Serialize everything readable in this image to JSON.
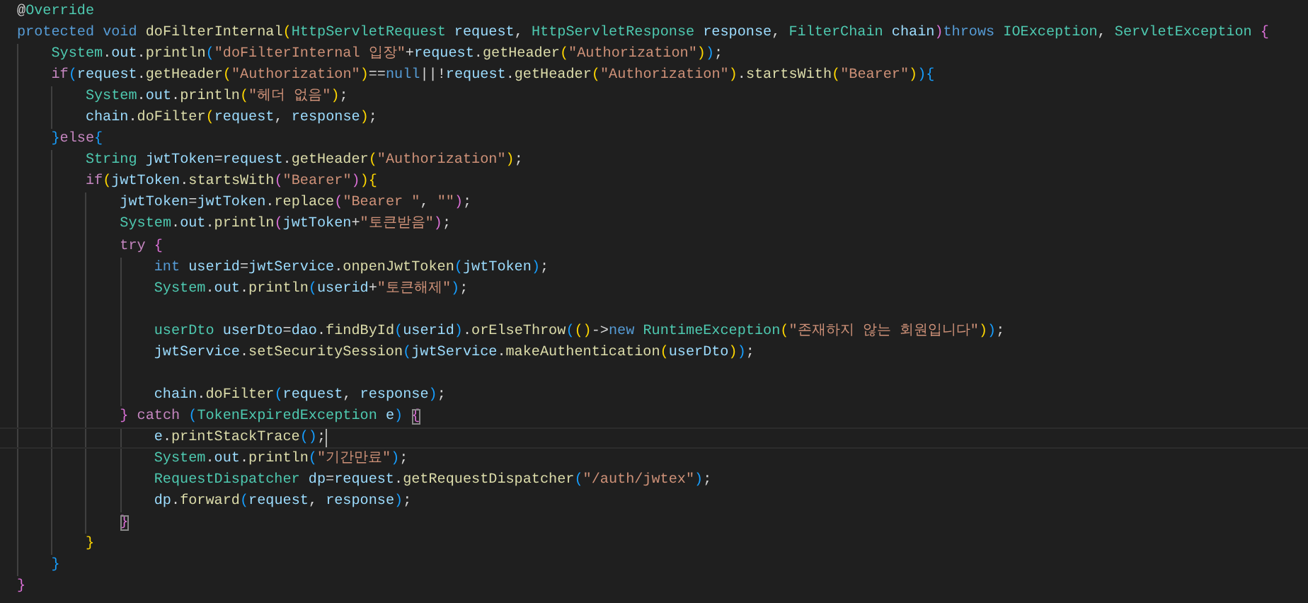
{
  "editor": {
    "lines": [
      {
        "current": false,
        "tokens": [
          {
            "kind": "plain",
            "text": "@"
          },
          {
            "kind": "type",
            "text": "Override"
          }
        ]
      },
      {
        "current": false,
        "tokens": [
          {
            "kind": "keyword",
            "text": "protected void "
          },
          {
            "kind": "method",
            "text": "doFilterInternal"
          },
          {
            "kind": "bracket1",
            "text": "("
          },
          {
            "kind": "type",
            "text": "HttpServletRequest"
          },
          {
            "kind": "variable",
            "text": " request"
          },
          {
            "kind": "plain",
            "text": ", "
          },
          {
            "kind": "type",
            "text": "HttpServletResponse"
          },
          {
            "kind": "variable",
            "text": " response"
          },
          {
            "kind": "plain",
            "text": ", "
          },
          {
            "kind": "type",
            "text": "FilterChain"
          },
          {
            "kind": "variable",
            "text": " chain"
          },
          {
            "kind": "bracket2",
            "text": ")"
          },
          {
            "kind": "keyword",
            "text": "throws "
          },
          {
            "kind": "type",
            "text": "IOException"
          },
          {
            "kind": "plain",
            "text": ", "
          },
          {
            "kind": "type",
            "text": "ServletException"
          },
          {
            "kind": "bracket2",
            "text": " {"
          }
        ],
        "children": [
          {
            "current": false,
            "tokens": [
              {
                "kind": "type",
                "text": "System"
              },
              {
                "kind": "plain",
                "text": "."
              },
              {
                "kind": "variable",
                "text": "out"
              },
              {
                "kind": "plain",
                "text": "."
              },
              {
                "kind": "method",
                "text": "println"
              },
              {
                "kind": "bracket3",
                "text": "("
              },
              {
                "kind": "string",
                "text": "\"doFilterInternal 입장\""
              },
              {
                "kind": "plain",
                "text": "+"
              },
              {
                "kind": "variable",
                "text": "request"
              },
              {
                "kind": "plain",
                "text": "."
              },
              {
                "kind": "method",
                "text": "getHeader"
              },
              {
                "kind": "bracket1",
                "text": "("
              },
              {
                "kind": "string",
                "text": "\"Authorization\""
              },
              {
                "kind": "bracket1",
                "text": ")"
              },
              {
                "kind": "bracket3",
                "text": ")"
              },
              {
                "kind": "plain",
                "text": ";"
              }
            ]
          },
          {
            "current": false,
            "tokens": [
              {
                "kind": "control",
                "text": "if"
              },
              {
                "kind": "bracket3",
                "text": "("
              },
              {
                "kind": "variable",
                "text": "request"
              },
              {
                "kind": "plain",
                "text": "."
              },
              {
                "kind": "method",
                "text": "getHeader"
              },
              {
                "kind": "bracket1",
                "text": "("
              },
              {
                "kind": "string",
                "text": "\"Authorization\""
              },
              {
                "kind": "bracket1",
                "text": ")"
              },
              {
                "kind": "plain",
                "text": "=="
              },
              {
                "kind": "keyword",
                "text": "null"
              },
              {
                "kind": "plain",
                "text": "||!"
              },
              {
                "kind": "variable",
                "text": "request"
              },
              {
                "kind": "plain",
                "text": "."
              },
              {
                "kind": "method",
                "text": "getHeader"
              },
              {
                "kind": "bracket1",
                "text": "("
              },
              {
                "kind": "string",
                "text": "\"Authorization\""
              },
              {
                "kind": "bracket1",
                "text": ")"
              },
              {
                "kind": "plain",
                "text": "."
              },
              {
                "kind": "method",
                "text": "startsWith"
              },
              {
                "kind": "bracket1",
                "text": "("
              },
              {
                "kind": "string",
                "text": "\"Bearer\""
              },
              {
                "kind": "bracket1",
                "text": ")"
              },
              {
                "kind": "bracket3",
                "text": "){"
              }
            ],
            "children": [
              {
                "current": false,
                "tokens": [
                  {
                    "kind": "type",
                    "text": "System"
                  },
                  {
                    "kind": "plain",
                    "text": "."
                  },
                  {
                    "kind": "variable",
                    "text": "out"
                  },
                  {
                    "kind": "plain",
                    "text": "."
                  },
                  {
                    "kind": "method",
                    "text": "println"
                  },
                  {
                    "kind": "bracket1",
                    "text": "("
                  },
                  {
                    "kind": "string",
                    "text": "\"헤더 없음\""
                  },
                  {
                    "kind": "bracket1",
                    "text": ")"
                  },
                  {
                    "kind": "plain",
                    "text": ";"
                  }
                ]
              },
              {
                "current": false,
                "tokens": [
                  {
                    "kind": "variable",
                    "text": "chain"
                  },
                  {
                    "kind": "plain",
                    "text": "."
                  },
                  {
                    "kind": "method",
                    "text": "doFilter"
                  },
                  {
                    "kind": "bracket1",
                    "text": "("
                  },
                  {
                    "kind": "variable",
                    "text": "request"
                  },
                  {
                    "kind": "plain",
                    "text": ", "
                  },
                  {
                    "kind": "variable",
                    "text": "response"
                  },
                  {
                    "kind": "bracket1",
                    "text": ")"
                  },
                  {
                    "kind": "plain",
                    "text": ";"
                  }
                ]
              }
            ]
          },
          {
            "current": false,
            "tokens": [
              {
                "kind": "bracket3",
                "text": "}"
              },
              {
                "kind": "control",
                "text": "else"
              },
              {
                "kind": "bracket3",
                "text": "{"
              }
            ],
            "children": [
              {
                "current": false,
                "tokens": [
                  {
                    "kind": "type",
                    "text": "String"
                  },
                  {
                    "kind": "variable",
                    "text": " jwtToken"
                  },
                  {
                    "kind": "plain",
                    "text": "="
                  },
                  {
                    "kind": "variable",
                    "text": "request"
                  },
                  {
                    "kind": "plain",
                    "text": "."
                  },
                  {
                    "kind": "method",
                    "text": "getHeader"
                  },
                  {
                    "kind": "bracket1",
                    "text": "("
                  },
                  {
                    "kind": "string",
                    "text": "\"Authorization\""
                  },
                  {
                    "kind": "bracket1",
                    "text": ")"
                  },
                  {
                    "kind": "plain",
                    "text": ";"
                  }
                ]
              },
              {
                "current": false,
                "tokens": [
                  {
                    "kind": "control",
                    "text": "if"
                  },
                  {
                    "kind": "bracket1",
                    "text": "("
                  },
                  {
                    "kind": "variable",
                    "text": "jwtToken"
                  },
                  {
                    "kind": "plain",
                    "text": "."
                  },
                  {
                    "kind": "method",
                    "text": "startsWith"
                  },
                  {
                    "kind": "bracket2",
                    "text": "("
                  },
                  {
                    "kind": "string",
                    "text": "\"Bearer\""
                  },
                  {
                    "kind": "bracket2",
                    "text": ")"
                  },
                  {
                    "kind": "bracket1",
                    "text": "){"
                  }
                ],
                "children": [
                  {
                    "current": false,
                    "tokens": [
                      {
                        "kind": "variable",
                        "text": "jwtToken"
                      },
                      {
                        "kind": "plain",
                        "text": "="
                      },
                      {
                        "kind": "variable",
                        "text": "jwtToken"
                      },
                      {
                        "kind": "plain",
                        "text": "."
                      },
                      {
                        "kind": "method",
                        "text": "replace"
                      },
                      {
                        "kind": "bracket2",
                        "text": "("
                      },
                      {
                        "kind": "string",
                        "text": "\"Bearer \""
                      },
                      {
                        "kind": "plain",
                        "text": ", "
                      },
                      {
                        "kind": "string",
                        "text": "\"\""
                      },
                      {
                        "kind": "bracket2",
                        "text": ")"
                      },
                      {
                        "kind": "plain",
                        "text": ";"
                      }
                    ]
                  },
                  {
                    "current": false,
                    "tokens": [
                      {
                        "kind": "type",
                        "text": "System"
                      },
                      {
                        "kind": "plain",
                        "text": "."
                      },
                      {
                        "kind": "variable",
                        "text": "out"
                      },
                      {
                        "kind": "plain",
                        "text": "."
                      },
                      {
                        "kind": "method",
                        "text": "println"
                      },
                      {
                        "kind": "bracket2",
                        "text": "("
                      },
                      {
                        "kind": "variable",
                        "text": "jwtToken"
                      },
                      {
                        "kind": "plain",
                        "text": "+"
                      },
                      {
                        "kind": "string",
                        "text": "\"토큰받음\""
                      },
                      {
                        "kind": "bracket2",
                        "text": ")"
                      },
                      {
                        "kind": "plain",
                        "text": ";"
                      }
                    ]
                  },
                  {
                    "current": false,
                    "tokens": [
                      {
                        "kind": "control",
                        "text": "try"
                      },
                      {
                        "kind": "bracket2",
                        "text": " {"
                      }
                    ],
                    "children": [
                      {
                        "current": false,
                        "tokens": [
                          {
                            "kind": "keyword",
                            "text": "int"
                          },
                          {
                            "kind": "variable",
                            "text": " userid"
                          },
                          {
                            "kind": "plain",
                            "text": "="
                          },
                          {
                            "kind": "variable",
                            "text": "jwtService"
                          },
                          {
                            "kind": "plain",
                            "text": "."
                          },
                          {
                            "kind": "method",
                            "text": "onpenJwtToken"
                          },
                          {
                            "kind": "bracket3",
                            "text": "("
                          },
                          {
                            "kind": "variable",
                            "text": "jwtToken"
                          },
                          {
                            "kind": "bracket3",
                            "text": ")"
                          },
                          {
                            "kind": "plain",
                            "text": ";"
                          }
                        ]
                      },
                      {
                        "current": false,
                        "tokens": [
                          {
                            "kind": "type",
                            "text": "System"
                          },
                          {
                            "kind": "plain",
                            "text": "."
                          },
                          {
                            "kind": "variable",
                            "text": "out"
                          },
                          {
                            "kind": "plain",
                            "text": "."
                          },
                          {
                            "kind": "method",
                            "text": "println"
                          },
                          {
                            "kind": "bracket3",
                            "text": "("
                          },
                          {
                            "kind": "variable",
                            "text": "userid"
                          },
                          {
                            "kind": "plain",
                            "text": "+"
                          },
                          {
                            "kind": "string",
                            "text": "\"토큰해제\""
                          },
                          {
                            "kind": "bracket3",
                            "text": ")"
                          },
                          {
                            "kind": "plain",
                            "text": ";"
                          }
                        ]
                      },
                      {
                        "current": false
                      },
                      {
                        "current": false,
                        "tokens": [
                          {
                            "kind": "type",
                            "text": "userDto"
                          },
                          {
                            "kind": "variable",
                            "text": " userDto"
                          },
                          {
                            "kind": "plain",
                            "text": "="
                          },
                          {
                            "kind": "variable",
                            "text": "dao"
                          },
                          {
                            "kind": "plain",
                            "text": "."
                          },
                          {
                            "kind": "method",
                            "text": "findById"
                          },
                          {
                            "kind": "bracket3",
                            "text": "("
                          },
                          {
                            "kind": "variable",
                            "text": "userid"
                          },
                          {
                            "kind": "bracket3",
                            "text": ")"
                          },
                          {
                            "kind": "plain",
                            "text": "."
                          },
                          {
                            "kind": "method",
                            "text": "orElseThrow"
                          },
                          {
                            "kind": "bracket3",
                            "text": "("
                          },
                          {
                            "kind": "bracket1",
                            "text": "()"
                          },
                          {
                            "kind": "plain",
                            "text": "->"
                          },
                          {
                            "kind": "keyword",
                            "text": "new"
                          },
                          {
                            "kind": "type",
                            "text": " RuntimeException"
                          },
                          {
                            "kind": "bracket1",
                            "text": "("
                          },
                          {
                            "kind": "string",
                            "text": "\"존재하지 않는 회원입니다\""
                          },
                          {
                            "kind": "bracket1",
                            "text": ")"
                          },
                          {
                            "kind": "bracket3",
                            "text": ")"
                          },
                          {
                            "kind": "plain",
                            "text": ";"
                          }
                        ]
                      },
                      {
                        "current": false,
                        "tokens": [
                          {
                            "kind": "variable",
                            "text": "jwtService"
                          },
                          {
                            "kind": "plain",
                            "text": "."
                          },
                          {
                            "kind": "method",
                            "text": "setSecuritySession"
                          },
                          {
                            "kind": "bracket3",
                            "text": "("
                          },
                          {
                            "kind": "variable",
                            "text": "jwtService"
                          },
                          {
                            "kind": "plain",
                            "text": "."
                          },
                          {
                            "kind": "method",
                            "text": "makeAuthentication"
                          },
                          {
                            "kind": "bracket1",
                            "text": "("
                          },
                          {
                            "kind": "variable",
                            "text": "userDto"
                          },
                          {
                            "kind": "bracket1",
                            "text": ")"
                          },
                          {
                            "kind": "bracket3",
                            "text": ")"
                          },
                          {
                            "kind": "plain",
                            "text": ";"
                          }
                        ]
                      },
                      {
                        "current": false
                      },
                      {
                        "current": false,
                        "tokens": [
                          {
                            "kind": "variable",
                            "text": "chain"
                          },
                          {
                            "kind": "plain",
                            "text": "."
                          },
                          {
                            "kind": "method",
                            "text": "doFilter"
                          },
                          {
                            "kind": "bracket3",
                            "text": "("
                          },
                          {
                            "kind": "variable",
                            "text": "request"
                          },
                          {
                            "kind": "plain",
                            "text": ", "
                          },
                          {
                            "kind": "variable",
                            "text": "response"
                          },
                          {
                            "kind": "bracket3",
                            "text": ")"
                          },
                          {
                            "kind": "plain",
                            "text": ";"
                          }
                        ]
                      }
                    ]
                  },
                  {
                    "current": false,
                    "tokens": [
                      {
                        "kind": "bracket2",
                        "text": "}"
                      },
                      {
                        "kind": "control",
                        "text": " catch "
                      },
                      {
                        "kind": "bracket3",
                        "text": "("
                      },
                      {
                        "kind": "type",
                        "text": "TokenExpiredException"
                      },
                      {
                        "kind": "variable",
                        "text": " e"
                      },
                      {
                        "kind": "bracket3",
                        "text": ") "
                      },
                      {
                        "kind": "matched-bracket",
                        "text": "{"
                      }
                    ],
                    "children": [
                      {
                        "current": true,
                        "tokens": [
                          {
                            "kind": "variable",
                            "text": "e"
                          },
                          {
                            "kind": "plain",
                            "text": "."
                          },
                          {
                            "kind": "method",
                            "text": "printStackTrace"
                          },
                          {
                            "kind": "bracket3",
                            "text": "()"
                          },
                          {
                            "kind": "plain",
                            "text": ";"
                          }
                        ]
                      },
                      {
                        "current": false,
                        "tokens": [
                          {
                            "kind": "type",
                            "text": "System"
                          },
                          {
                            "kind": "plain",
                            "text": "."
                          },
                          {
                            "kind": "variable",
                            "text": "out"
                          },
                          {
                            "kind": "plain",
                            "text": "."
                          },
                          {
                            "kind": "method",
                            "text": "println"
                          },
                          {
                            "kind": "bracket3",
                            "text": "("
                          },
                          {
                            "kind": "string",
                            "text": "\"기간만료\""
                          },
                          {
                            "kind": "bracket3",
                            "text": ")"
                          },
                          {
                            "kind": "plain",
                            "text": ";"
                          }
                        ]
                      },
                      {
                        "current": false,
                        "tokens": [
                          {
                            "kind": "type",
                            "text": "RequestDispatcher"
                          },
                          {
                            "kind": "variable",
                            "text": " dp"
                          },
                          {
                            "kind": "plain",
                            "text": "="
                          },
                          {
                            "kind": "variable",
                            "text": "request"
                          },
                          {
                            "kind": "plain",
                            "text": "."
                          },
                          {
                            "kind": "method",
                            "text": "getRequestDispatcher"
                          },
                          {
                            "kind": "bracket3",
                            "text": "("
                          },
                          {
                            "kind": "string",
                            "text": "\"/auth/jwtex\""
                          },
                          {
                            "kind": "bracket3",
                            "text": ")"
                          },
                          {
                            "kind": "plain",
                            "text": ";"
                          }
                        ]
                      },
                      {
                        "current": false,
                        "tokens": [
                          {
                            "kind": "variable",
                            "text": "dp"
                          },
                          {
                            "kind": "plain",
                            "text": "."
                          },
                          {
                            "kind": "method",
                            "text": "forward"
                          },
                          {
                            "kind": "bracket3",
                            "text": "("
                          },
                          {
                            "kind": "variable",
                            "text": "request"
                          },
                          {
                            "kind": "plain",
                            "text": ", "
                          },
                          {
                            "kind": "variable",
                            "text": "response"
                          },
                          {
                            "kind": "bracket3",
                            "text": ")"
                          },
                          {
                            "kind": "plain",
                            "text": ";"
                          }
                        ]
                      }
                    ]
                  },
                  {
                    "current": false,
                    "tokens": [
                      {
                        "kind": "matched-bracket",
                        "text": "}"
                      }
                    ]
                  }
                ]
              },
              {
                "current": false,
                "tokens": [
                  {
                    "kind": "bracket1",
                    "text": "}"
                  }
                ]
              }
            ]
          },
          {
            "current": false,
            "tokens": [
              {
                "kind": "bracket3",
                "text": "}"
              }
            ]
          }
        ]
      },
      {
        "current": false,
        "tokens": [
          {
            "kind": "bracket2",
            "text": "}"
          }
        ]
      }
    ]
  }
}
